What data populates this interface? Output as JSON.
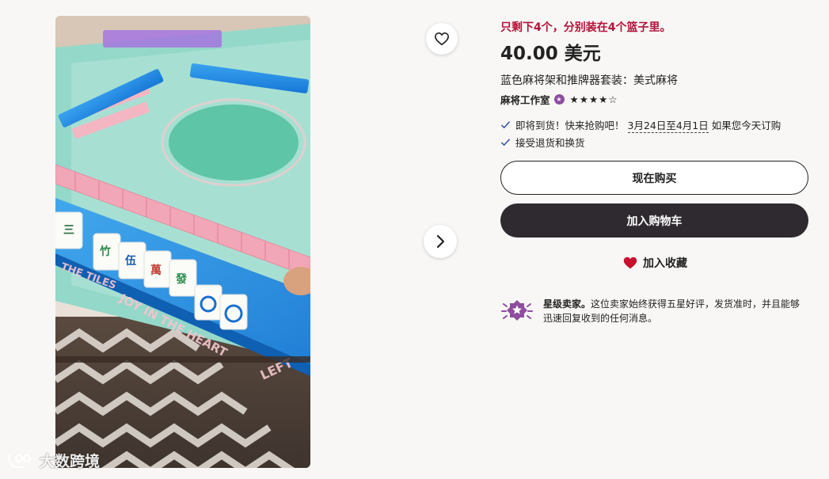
{
  "product": {
    "stock_notice": "只剩下4个，分别装在4个篮子里。",
    "price": "40.00 美元",
    "title": "蓝色麻将架和推牌器套装：美式麻将",
    "rating": 4.5
  },
  "shop": {
    "name": "麻将工作室"
  },
  "shipping": {
    "arrival_prefix": "即将到货！快来抢购吧！",
    "arrival_dates": "3月24日至4月1日",
    "arrival_suffix": "如果您今天订购",
    "returns": "接受退货和换货"
  },
  "actions": {
    "buy_now": "现在购买",
    "add_to_cart": "加入购物车",
    "add_to_favorites": "加入收藏"
  },
  "star_seller": {
    "label": "星级卖家。",
    "description": "这位卖家始终获得五星好评，发货准时，并且能够迅速回复收到的任何消息。"
  },
  "photo": {
    "mat_text_1": "THE TILES",
    "mat_text_2": "JOY IN THE HEART",
    "mat_text_3": "LEFT"
  },
  "watermark": {
    "text": "大数跨境"
  },
  "colors": {
    "accent_red": "#b3123a",
    "cart_button": "#2f2a30",
    "heart": "#c8102e",
    "star_seller_purple": "#8e4d9e"
  },
  "icons": {
    "favorite": "heart-outline-icon",
    "next": "chevron-right-icon",
    "check": "check-icon",
    "star_seller": "star-seller-badge-icon"
  }
}
